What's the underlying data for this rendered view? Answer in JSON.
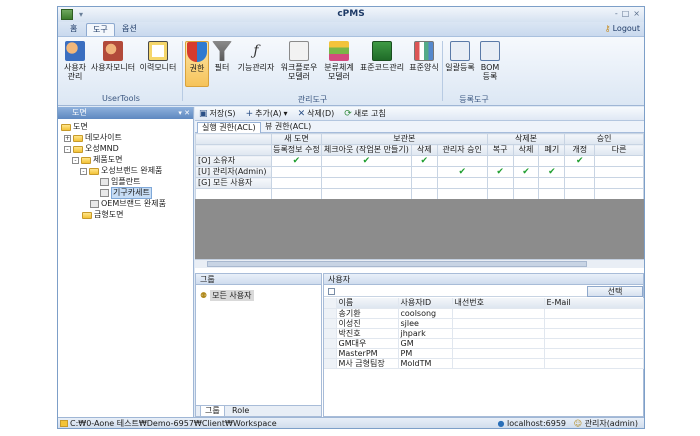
{
  "window": {
    "title": "cPMS",
    "controls": [
      "-",
      "□",
      "×"
    ]
  },
  "menu": {
    "tabs": [
      {
        "label": "홈"
      },
      {
        "label": "도구"
      },
      {
        "label": "옵션"
      }
    ],
    "active_tab": "도구",
    "logout": "Logout"
  },
  "ribbon": {
    "groups": [
      {
        "label": "UserTools",
        "buttons": [
          {
            "label": "사용자\n관리"
          },
          {
            "label": "사용자모니터"
          },
          {
            "label": "이력모니터"
          }
        ]
      },
      {
        "label": "관리도구",
        "buttons": [
          {
            "label": "권한"
          },
          {
            "label": "필터"
          },
          {
            "label": "기능관리자"
          },
          {
            "label": "워크플로우\n모델러"
          },
          {
            "label": "분류체계\n모델러"
          },
          {
            "label": "표준코드관리"
          },
          {
            "label": "표준양식"
          }
        ]
      },
      {
        "label": "등록도구",
        "buttons": [
          {
            "label": "일괄등록"
          },
          {
            "label": "BOM\n등록"
          }
        ]
      }
    ]
  },
  "tree": {
    "title": "도면",
    "items": [
      {
        "label": "도면",
        "toggle": ""
      },
      {
        "label": "데모사이트",
        "toggle": "+"
      },
      {
        "label": "오성MND",
        "toggle": "-"
      },
      {
        "label": "제품도면",
        "toggle": "-"
      },
      {
        "label": "오성브랜드 완제품",
        "toggle": "-"
      },
      {
        "label": "임플란트",
        "toggle": ""
      },
      {
        "label": "기구카세트",
        "toggle": ""
      },
      {
        "label": "OEM브랜드 완제품",
        "toggle": ""
      },
      {
        "label": "금형도면",
        "toggle": ""
      }
    ]
  },
  "toolbar": {
    "save": "저장(S)",
    "add": "추가(A)",
    "delete": "삭제(D)",
    "refresh": "새로 고침"
  },
  "subtabs": [
    {
      "label": "실행 권한(ACL)"
    },
    {
      "label": "뷰 권한(ACL)"
    }
  ],
  "acl_grid": {
    "group_headers": [
      {
        "label": "새 도면"
      },
      {
        "label": "보관본"
      },
      {
        "label": "삭제본"
      },
      {
        "label": "승인"
      }
    ],
    "columns": [
      "등록정보 수정",
      "체크아웃 (작업본 만들기)",
      "삭제",
      "관리자 승인",
      "복구",
      "삭제",
      "폐기",
      "개정",
      "다른"
    ],
    "rows": [
      {
        "label": "[O] 소유자",
        "checks": [
          true,
          true,
          true,
          false,
          false,
          false,
          false,
          true,
          false
        ]
      },
      {
        "label": "[U] 관리자(Admin)",
        "checks": [
          false,
          false,
          false,
          true,
          true,
          true,
          true,
          false,
          false
        ]
      },
      {
        "label": "[G] 모든 사용자",
        "checks": [
          false,
          false,
          false,
          false,
          false,
          false,
          false,
          false,
          false
        ]
      }
    ]
  },
  "groups_pane": {
    "title": "그룹",
    "items": [
      {
        "label": "모든 사용자"
      }
    ],
    "tabs": [
      {
        "label": "그룹"
      },
      {
        "label": "Role"
      }
    ]
  },
  "users_pane": {
    "title": "사용자",
    "select_button": "선택",
    "columns": [
      "이름",
      "사용자ID",
      "내선번호",
      "E-Mail"
    ],
    "rows": [
      {
        "name": "송기환",
        "id": "coolsong",
        "ext": "",
        "email": ""
      },
      {
        "name": "이성진",
        "id": "sjlee",
        "ext": "",
        "email": ""
      },
      {
        "name": "박진호",
        "id": "jhpark",
        "ext": "",
        "email": ""
      },
      {
        "name": "GM대우",
        "id": "GM",
        "ext": "",
        "email": ""
      },
      {
        "name": "MasterPM",
        "id": "PM",
        "ext": "",
        "email": ""
      },
      {
        "name": "M사 금형팀장",
        "id": "MoldTM",
        "ext": "",
        "email": ""
      }
    ]
  },
  "status": {
    "path": "C:₩0-Aone 테스트₩Demo-6957₩Client₩Workspace",
    "host": "localhost:6959",
    "user": "관리자(admin)"
  }
}
